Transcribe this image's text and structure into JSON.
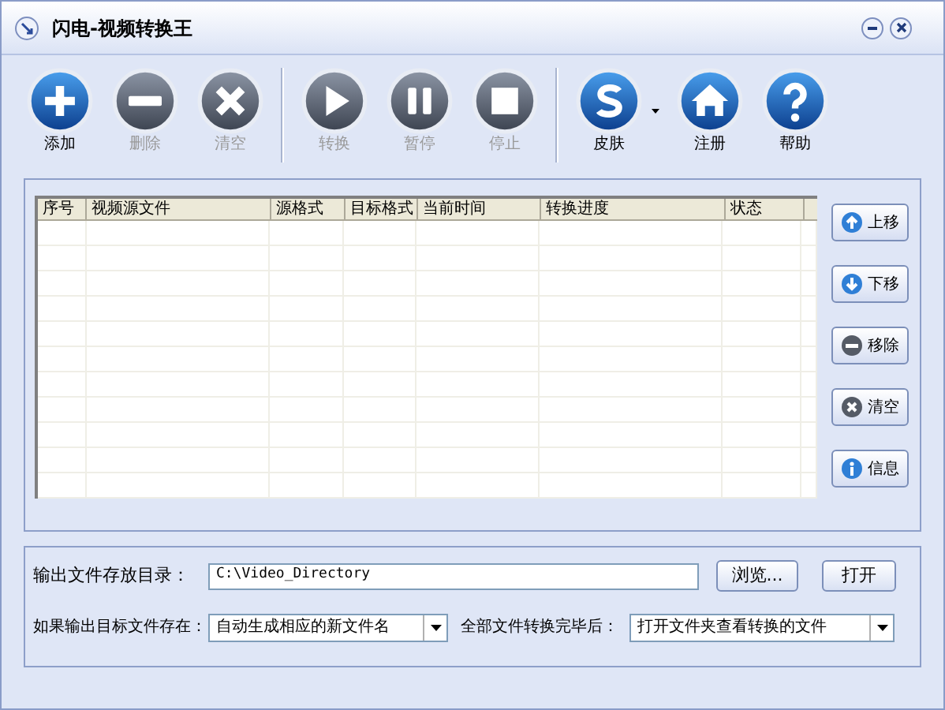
{
  "window": {
    "title": "闪电-视频转换王"
  },
  "toolbar": [
    {
      "kind": "add",
      "label": "添加",
      "disabled": false
    },
    {
      "kind": "remove",
      "label": "删除",
      "disabled": true
    },
    {
      "kind": "clear",
      "label": "清空",
      "disabled": true
    },
    {
      "kind": "play",
      "label": "转换",
      "disabled": true
    },
    {
      "kind": "pause",
      "label": "暂停",
      "disabled": true
    },
    {
      "kind": "stop",
      "label": "停止",
      "disabled": true
    },
    {
      "kind": "skin",
      "label": "皮肤",
      "disabled": false
    },
    {
      "kind": "home",
      "label": "注册",
      "disabled": false
    },
    {
      "kind": "help",
      "label": "帮助",
      "disabled": false
    }
  ],
  "table": {
    "columns": [
      "序号",
      "视频源文件",
      "源格式",
      "目标格式",
      "当前时间",
      "转换进度",
      "状态"
    ]
  },
  "side_buttons": [
    {
      "kind": "up",
      "label": "上移"
    },
    {
      "kind": "down",
      "label": "下移"
    },
    {
      "kind": "remove",
      "label": "移除"
    },
    {
      "kind": "clear",
      "label": "清空"
    },
    {
      "kind": "info",
      "label": "信息"
    }
  ],
  "output": {
    "dir_label": "输出文件存放目录：",
    "dir_value": "C:\\Video_Directory",
    "browse": "浏览...",
    "open": "打开",
    "exists_label": "如果输出目标文件存在：",
    "exists_value": "自动生成相应的新文件名",
    "after_label": "全部文件转换完毕后：",
    "after_value": "打开文件夹查看转换的文件"
  }
}
